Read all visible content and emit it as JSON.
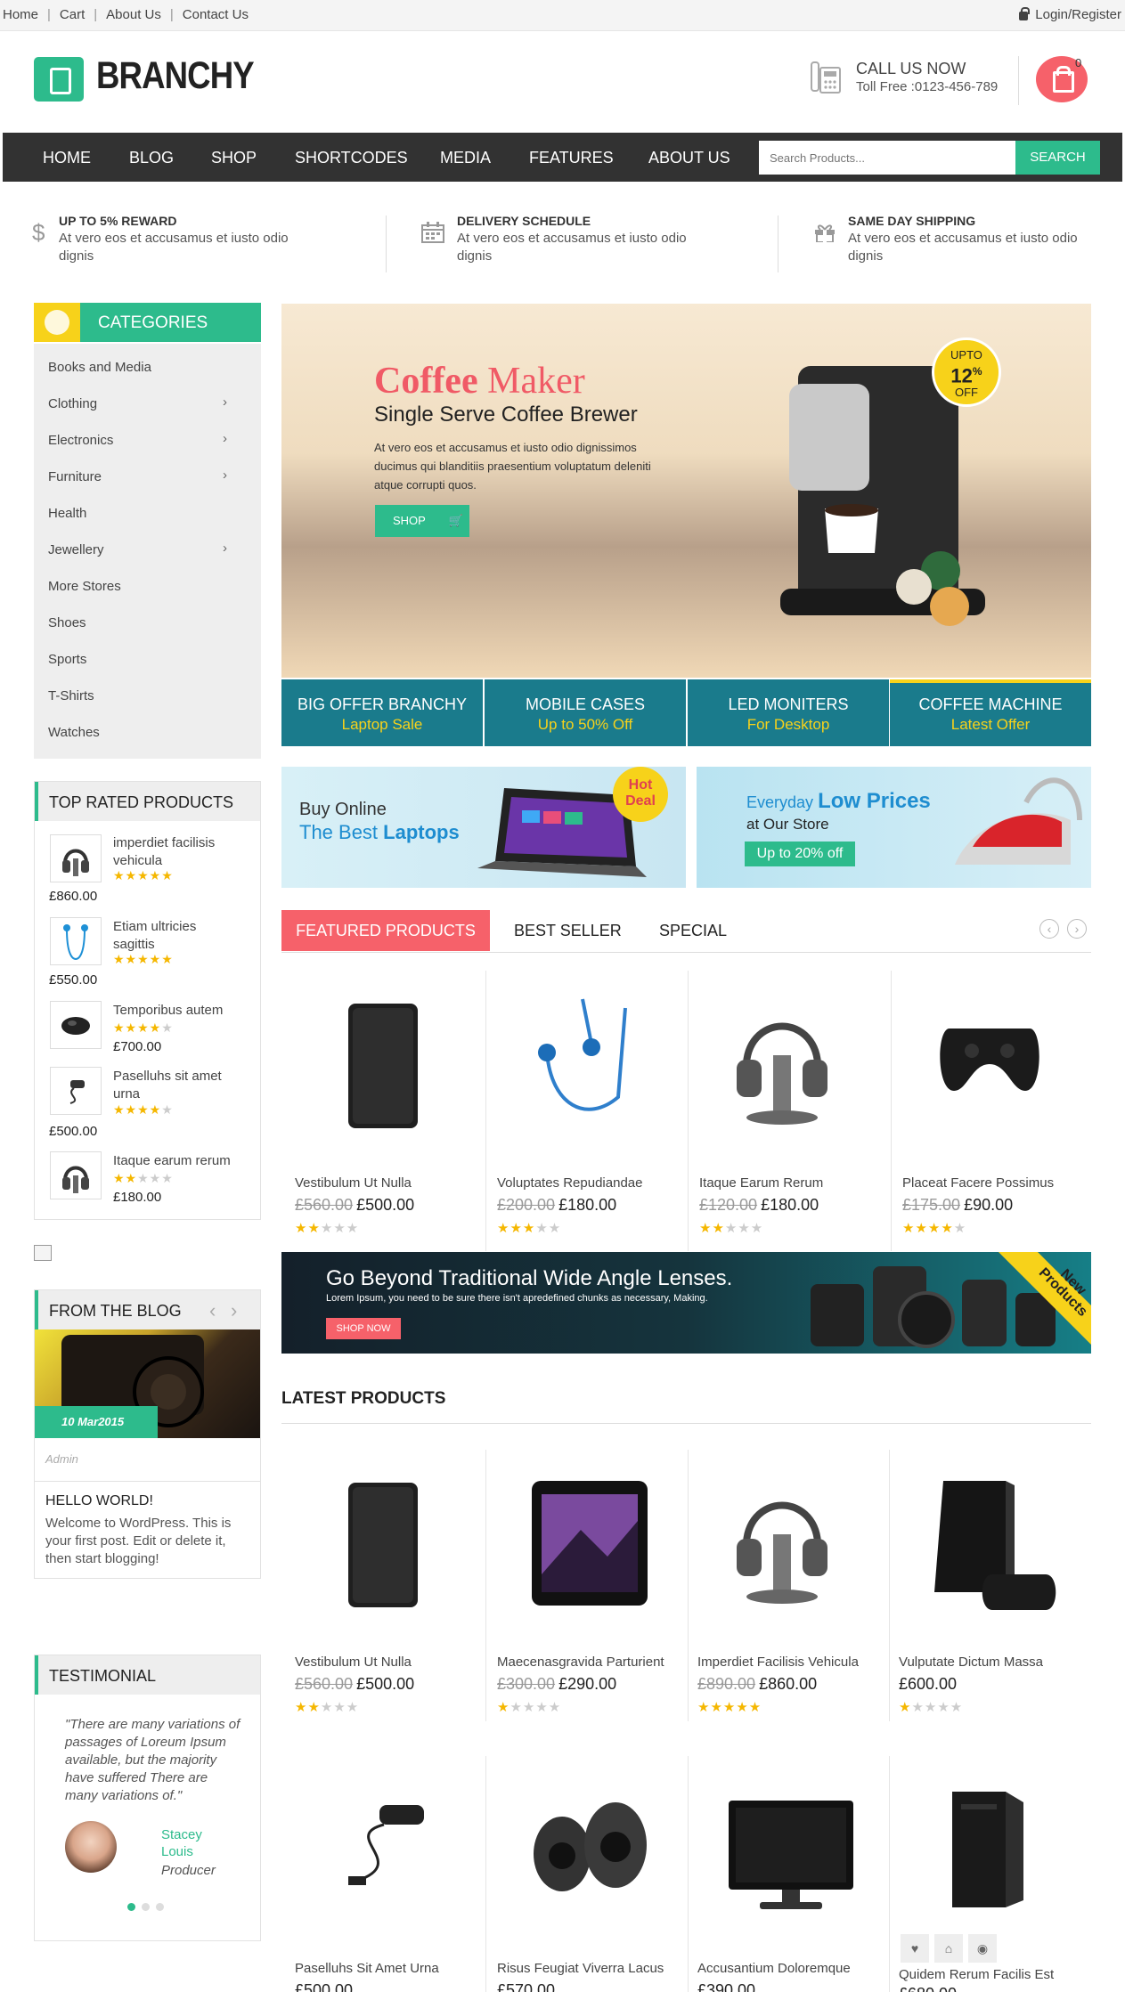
{
  "topbar": {
    "links": [
      "Home",
      "Cart",
      "About Us",
      "Contact Us"
    ],
    "login": "Login/Register"
  },
  "header": {
    "logo": "BRANCHY",
    "call_title": "CALL US NOW",
    "call_number": "Toll Free :0123-456-789",
    "cart_count": "0"
  },
  "nav": {
    "items": [
      "HOME",
      "BLOG",
      "SHOP",
      "SHORTCODES",
      "MEDIA",
      "FEATURES",
      "ABOUT US"
    ],
    "search_placeholder": "Search Products...",
    "search_button": "SEARCH"
  },
  "features": [
    {
      "title": "UP TO 5% REWARD",
      "desc": "At vero eos et accusamus et iusto odio dignis",
      "icon": "dollar-icon"
    },
    {
      "title": "DELIVERY SCHEDULE",
      "desc": "At vero eos et accusamus et iusto odio dignis",
      "icon": "calendar-icon"
    },
    {
      "title": "SAME DAY SHIPPING",
      "desc": "At vero eos et accusamus et iusto odio dignis",
      "icon": "gift-icon"
    }
  ],
  "categories": {
    "title": "CATEGORIES",
    "items": [
      {
        "label": "Books and Media",
        "sub": false
      },
      {
        "label": "Clothing",
        "sub": true
      },
      {
        "label": "Electronics",
        "sub": true
      },
      {
        "label": "Furniture",
        "sub": true
      },
      {
        "label": "Health",
        "sub": false
      },
      {
        "label": "Jewellery",
        "sub": true
      },
      {
        "label": "More Stores",
        "sub": false
      },
      {
        "label": "Shoes",
        "sub": false
      },
      {
        "label": "Sports",
        "sub": false
      },
      {
        "label": "T-Shirts",
        "sub": false
      },
      {
        "label": "Watches",
        "sub": false
      }
    ]
  },
  "top_rated": {
    "title": "TOP RATED PRODUCTS",
    "items": [
      {
        "name": "imperdiet facilisis vehicula",
        "rating": 5,
        "price": "£860.00"
      },
      {
        "name": "Etiam ultricies sagittis",
        "rating": 5,
        "price": "£550.00"
      },
      {
        "name": "Temporibus autem",
        "rating": 4,
        "price": "£700.00"
      },
      {
        "name": "Paselluhs sit amet urna",
        "rating": 4,
        "price": "£500.00"
      },
      {
        "name": "Itaque earum rerum",
        "rating": 2,
        "price": "£180.00"
      }
    ]
  },
  "blog": {
    "title": "FROM THE BLOG",
    "date": "10 Mar2015",
    "author": "Admin",
    "post_title": "HELLO WORLD!",
    "excerpt": "Welcome to WordPress. This is your first post. Edit or delete it, then start blogging!"
  },
  "testimonial": {
    "title": "TESTIMONIAL",
    "quote": "\"There are many variations of passages of Loreum Ipsum available, but the majority have suffered There are many variations of.\"",
    "name": "Stacey Louis",
    "role": "Producer"
  },
  "hero": {
    "title_a": "Coffee",
    "title_b": "Maker",
    "subtitle": "Single Serve Coffee Brewer",
    "desc": "At vero eos et accusamus et iusto odio dignissimos ducimus qui blanditiis praesentium voluptatum deleniti atque corrupti quos.",
    "button": "SHOP",
    "badge_top": "UPTO",
    "badge_num": "12",
    "badge_pct": "%",
    "badge_bottom": "OFF"
  },
  "hero_tabs": [
    {
      "title": "BIG OFFER BRANCHY",
      "sub": "Laptop Sale"
    },
    {
      "title": "MOBILE CASES",
      "sub": "Up to 50% Off"
    },
    {
      "title": "LED MONITERS",
      "sub": "For Desktop"
    },
    {
      "title": "COFFEE MACHINE",
      "sub": "Latest Offer"
    }
  ],
  "banner_laptop": {
    "line1": "Buy Online",
    "line2a": "The Best",
    "line2b": "Laptops",
    "badge1": "Hot",
    "badge2": "Deal"
  },
  "banner_iron": {
    "line1a": "Everyday",
    "line1b": "Low Prices",
    "line2": "at Our Store",
    "badge": "Up to 20% off"
  },
  "product_tabs": [
    "FEATURED PRODUCTS",
    "BEST SELLER",
    "SPECIAL"
  ],
  "featured": [
    {
      "name": "Vestibulum Ut Nulla",
      "old": "£560.00",
      "price": "£500.00",
      "rating": 2
    },
    {
      "name": "Voluptates Repudiandae",
      "old": "£200.00",
      "price": "£180.00",
      "rating": 3
    },
    {
      "name": "Itaque Earum Rerum",
      "old": "£120.00",
      "price": "£180.00",
      "rating": 2
    },
    {
      "name": "Placeat Facere Possimus",
      "old": "£175.00",
      "price": "£90.00",
      "rating": 4
    }
  ],
  "lens_banner": {
    "title": "Go Beyond Traditional Wide Angle Lenses.",
    "desc": "Lorem Ipsum, you need to be sure there isn't apredefined chunks as necessary, Making.",
    "button": "SHOP NOW",
    "ribbon1": "New",
    "ribbon2": "Products"
  },
  "latest": {
    "title": "LATEST PRODUCTS",
    "row1": [
      {
        "name": "Vestibulum Ut Nulla",
        "old": "£560.00",
        "price": "£500.00",
        "rating": 2
      },
      {
        "name": "Maecenasgravida Parturient",
        "old": "£300.00",
        "price": "£290.00",
        "rating": 1
      },
      {
        "name": "Imperdiet Facilisis Vehicula",
        "old": "£890.00",
        "price": "£860.00",
        "rating": 5
      },
      {
        "name": "Vulputate Dictum Massa",
        "old": "",
        "price": "£600.00",
        "rating": 1
      }
    ],
    "row2": [
      {
        "name": "Paselluhs Sit Amet Urna",
        "price": "£500.00"
      },
      {
        "name": "Risus Feugiat Viverra Lacus",
        "price": "£570.00"
      },
      {
        "name": "Accusantium Doloremque",
        "price": "£390.00"
      },
      {
        "name": "Quidem Rerum Facilis Est",
        "price": "£680.00"
      }
    ]
  },
  "colors": {
    "accent": "#2dbb8c",
    "pink": "#f6616a",
    "teal": "#1a7b8c",
    "yellow": "#f7d21a",
    "nav": "#323232"
  }
}
